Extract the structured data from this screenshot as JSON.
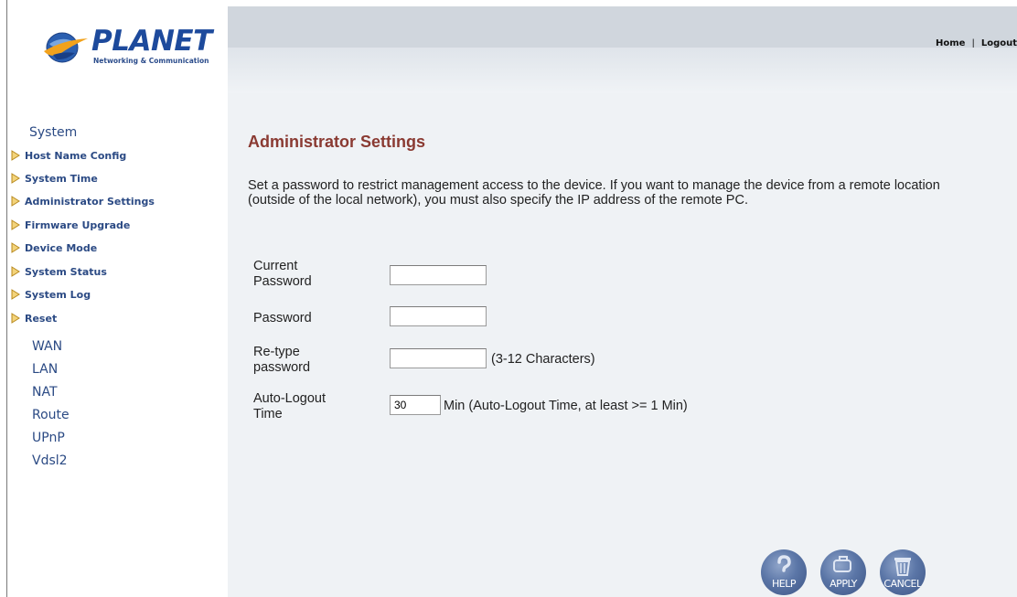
{
  "brand": {
    "name": "PLANET",
    "tagline": "Networking & Communication"
  },
  "top_links": {
    "home": "Home",
    "separator": "|",
    "logout": "Logout"
  },
  "sidebar": {
    "system": "System",
    "system_items": [
      {
        "label": "Host Name Config"
      },
      {
        "label": "System Time"
      },
      {
        "label": "Administrator Settings"
      },
      {
        "label": "Firmware Upgrade"
      },
      {
        "label": "Device Mode"
      },
      {
        "label": "System Status"
      },
      {
        "label": "System Log"
      },
      {
        "label": "Reset"
      }
    ],
    "sections": [
      {
        "label": "WAN"
      },
      {
        "label": "LAN"
      },
      {
        "label": "NAT"
      },
      {
        "label": "Route"
      },
      {
        "label": "UPnP"
      },
      {
        "label": "Vdsl2"
      }
    ]
  },
  "page": {
    "title": "Administrator Settings",
    "description": "Set a password to restrict management access to the device. If you want to manage the device from a remote location (outside of the local network), you must also specify the IP address of the remote PC."
  },
  "form": {
    "current_password_label": "Current Password",
    "current_password_value": "",
    "password_label": "Password",
    "password_value": "",
    "retype_label": "Re-type password",
    "retype_value": "",
    "retype_hint": "(3-12 Characters)",
    "autologout_label": "Auto-Logout Time",
    "autologout_value": "30",
    "autologout_hint": "Min (Auto-Logout Time, at least >= 1 Min)"
  },
  "buttons": {
    "help": "HELP",
    "apply": "APPLY",
    "cancel": "CANCEL"
  },
  "colors": {
    "title": "#8a3a32",
    "nav": "#2b4a84",
    "arrow": "#e3b43a",
    "background": "#eff2f5"
  }
}
